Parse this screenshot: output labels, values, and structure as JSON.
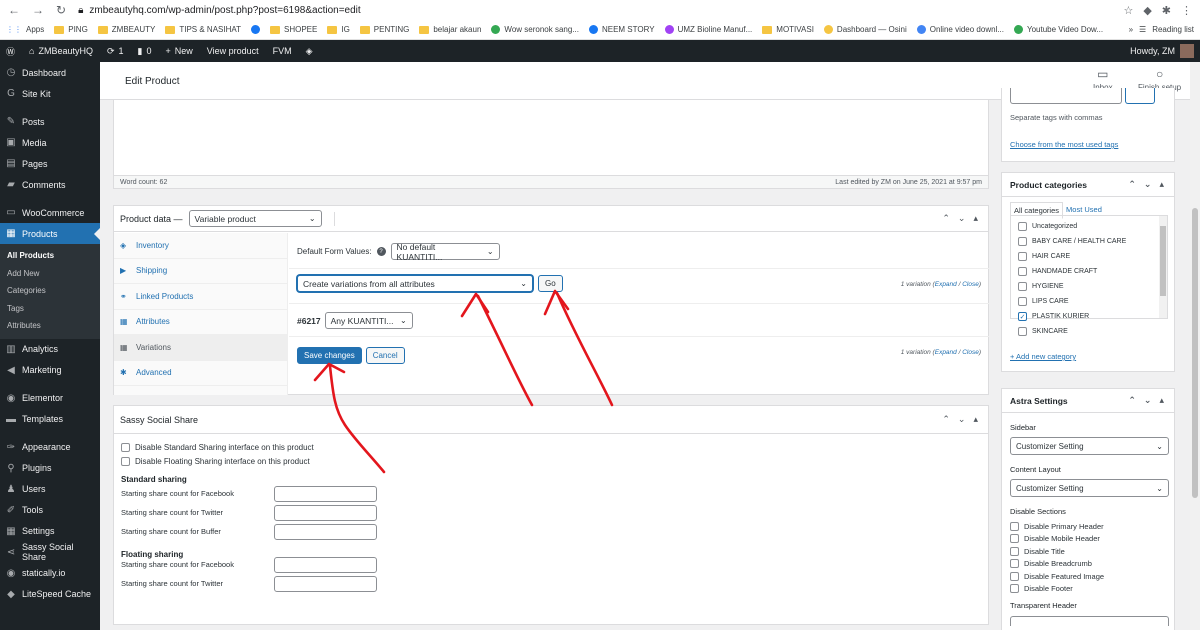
{
  "browser": {
    "url": "zmbeautyhq.com/wp-admin/post.php?post=6198&action=edit",
    "bookmarks": [
      "Apps",
      "PING",
      "ZMBEAUTY",
      "TIPS & NASIHAT",
      "",
      "SHOPEE",
      "IG",
      "PENTING",
      "belajar akaun",
      "Wow seronok sang...",
      "NEEM STORY",
      "UMZ Bioline Manuf...",
      "MOTIVASI",
      "Dashboard — Osini",
      "Online video downl...",
      "Youtube Video Dow..."
    ],
    "reading_list": "Reading list",
    "more": "»"
  },
  "adminbar": {
    "site": "ZMBeautyHQ",
    "updates": "1",
    "comments": "0",
    "new": "New",
    "view": "View product",
    "fvm": "FVM",
    "howdy": "Howdy, ZM"
  },
  "sidebar": {
    "items": [
      {
        "label": "Dashboard",
        "icon": "dashboard-icon"
      },
      {
        "label": "Site Kit",
        "icon": "google-icon"
      },
      {
        "label": "Posts",
        "icon": "pin-icon"
      },
      {
        "label": "Media",
        "icon": "media-icon"
      },
      {
        "label": "Pages",
        "icon": "page-icon"
      },
      {
        "label": "Comments",
        "icon": "comment-icon"
      },
      {
        "label": "WooCommerce",
        "icon": "woo-icon"
      },
      {
        "label": "Products",
        "icon": "archive-icon"
      },
      {
        "label": "Analytics",
        "icon": "chart-icon"
      },
      {
        "label": "Marketing",
        "icon": "megaphone-icon"
      },
      {
        "label": "Elementor",
        "icon": "elementor-icon"
      },
      {
        "label": "Templates",
        "icon": "folder-icon"
      },
      {
        "label": "Appearance",
        "icon": "brush-icon"
      },
      {
        "label": "Plugins",
        "icon": "plugin-icon"
      },
      {
        "label": "Users",
        "icon": "user-icon"
      },
      {
        "label": "Tools",
        "icon": "wrench-icon"
      },
      {
        "label": "Settings",
        "icon": "settings-icon"
      },
      {
        "label": "Sassy Social Share",
        "icon": "share-icon"
      },
      {
        "label": "statically.io",
        "icon": "statically-icon"
      },
      {
        "label": "LiteSpeed Cache",
        "icon": "diamond-icon"
      }
    ],
    "products_submenu": [
      "All Products",
      "Add New",
      "Categories",
      "Tags",
      "Attributes"
    ]
  },
  "header": {
    "title": "Edit Product",
    "inbox": "Inbox",
    "finish_setup": "Finish setup"
  },
  "editor": {
    "word_count": "Word count: 62",
    "last_edited": "Last edited by ZM on June 25, 2021 at 9:57 pm"
  },
  "product_data": {
    "label": "Product data —",
    "type": "Variable product",
    "tabs": [
      {
        "label": "Inventory",
        "icon": "inventory-icon"
      },
      {
        "label": "Shipping",
        "icon": "truck-icon"
      },
      {
        "label": "Linked Products",
        "icon": "link-icon"
      },
      {
        "label": "Attributes",
        "icon": "list-icon"
      },
      {
        "label": "Variations",
        "icon": "grid-icon"
      },
      {
        "label": "Advanced",
        "icon": "gear-icon"
      }
    ],
    "default_form_values_label": "Default Form Values:",
    "default_form_values": "No default KUANTITI...",
    "bulk_action": "Create variations from all attributes",
    "go": "Go",
    "variation_count": "1 variation",
    "expand": "Expand",
    "close": "Close",
    "variation_id": "#6217",
    "variation_value": "Any KUANTITI...",
    "save": "Save changes",
    "cancel": "Cancel"
  },
  "sassy": {
    "title": "Sassy Social Share",
    "opt1": "Disable Standard Sharing interface on this product",
    "opt2": "Disable Floating Sharing interface on this product",
    "standard_title": "Standard sharing",
    "standard_rows": [
      "Starting share count for Facebook",
      "Starting share count for Twitter",
      "Starting share count for Buffer"
    ],
    "floating_title": "Floating sharing",
    "floating_rows": [
      "Starting share count for Facebook",
      "Starting share count for Twitter"
    ]
  },
  "tags_box": {
    "hint": "Separate tags with commas",
    "choose": "Choose from the most used tags"
  },
  "categories": {
    "title": "Product categories",
    "tab_all": "All categories",
    "tab_most": "Most Used",
    "items": [
      {
        "label": "Uncategorized",
        "checked": false
      },
      {
        "label": "BABY CARE / HEALTH CARE",
        "checked": false
      },
      {
        "label": "HAIR CARE",
        "checked": false
      },
      {
        "label": "HANDMADE CRAFT",
        "checked": false
      },
      {
        "label": "HYGIENE",
        "checked": false
      },
      {
        "label": "LIPS CARE",
        "checked": false
      },
      {
        "label": "PLASTIK KURIER",
        "checked": true
      },
      {
        "label": "SKINCARE",
        "checked": false
      }
    ],
    "add_new": "+ Add new category"
  },
  "astra": {
    "title": "Astra Settings",
    "sidebar_label": "Sidebar",
    "sidebar_value": "Customizer Setting",
    "layout_label": "Content Layout",
    "layout_value": "Customizer Setting",
    "disable_label": "Disable Sections",
    "disable_items": [
      "Disable Primary Header",
      "Disable Mobile Header",
      "Disable Title",
      "Disable Breadcrumb",
      "Disable Featured Image",
      "Disable Footer"
    ],
    "transparent_label": "Transparent Header"
  },
  "colors": {
    "admin_dark": "#1d2327",
    "accent": "#2271b1",
    "annotation": "#e3161d"
  }
}
